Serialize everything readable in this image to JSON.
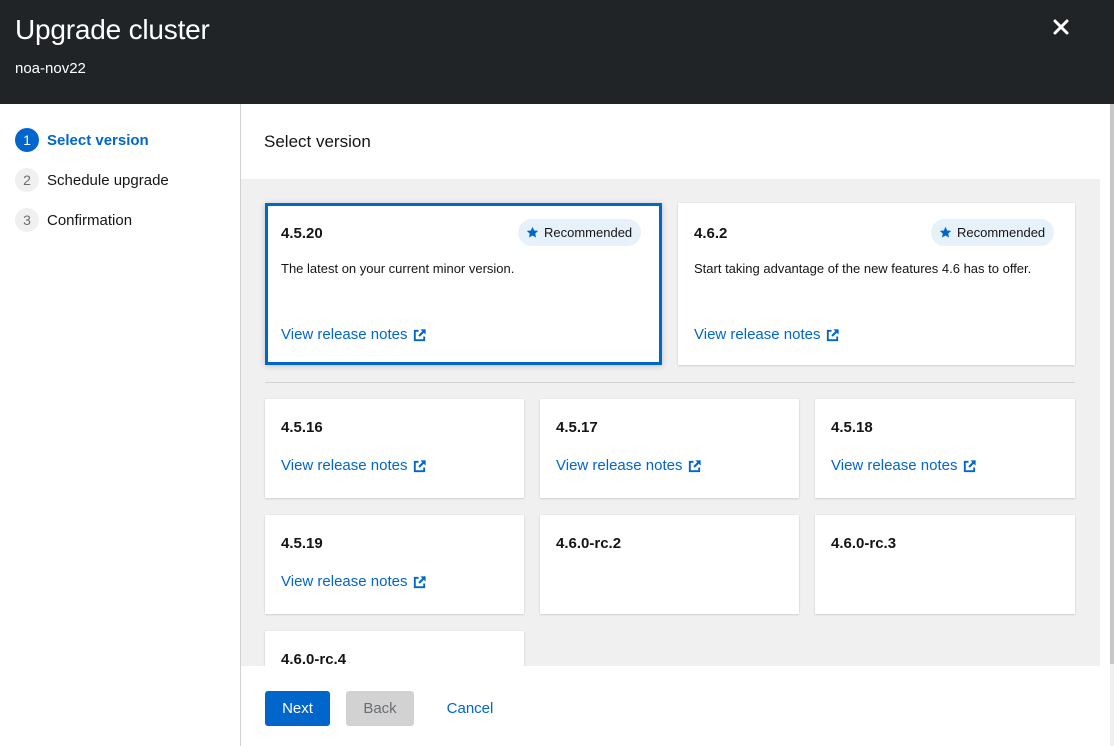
{
  "header": {
    "title": "Upgrade cluster",
    "subtitle": "noa-nov22"
  },
  "wizard_nav": [
    {
      "number": "1",
      "label": "Select version",
      "active": true
    },
    {
      "number": "2",
      "label": "Schedule upgrade",
      "active": false
    },
    {
      "number": "3",
      "label": "Confirmation",
      "active": false
    }
  ],
  "main": {
    "title": "Select version"
  },
  "recommended_cards": [
    {
      "version": "4.5.20",
      "badge": "Recommended",
      "description": "The latest on your current minor version.",
      "link": "View release notes",
      "selected": true
    },
    {
      "version": "4.6.2",
      "badge": "Recommended",
      "description": "Start taking advantage of the new features 4.6 has to offer.",
      "link": "View release notes",
      "selected": false
    }
  ],
  "version_cards": [
    {
      "version": "4.5.16",
      "link": "View release notes"
    },
    {
      "version": "4.5.17",
      "link": "View release notes"
    },
    {
      "version": "4.5.18",
      "link": "View release notes"
    },
    {
      "version": "4.5.19",
      "link": "View release notes"
    },
    {
      "version": "4.6.0-rc.2",
      "link": ""
    },
    {
      "version": "4.6.0-rc.3",
      "link": ""
    },
    {
      "version": "4.6.0-rc.4",
      "link": ""
    }
  ],
  "footer": {
    "next_label": "Next",
    "back_label": "Back",
    "cancel_label": "Cancel"
  },
  "colors": {
    "header_bg": "#212427",
    "accent": "#0066cc",
    "badge_bg": "#e7f1fa",
    "content_bg": "#f0f0f0"
  },
  "icons": {
    "close": "close-icon",
    "star": "star-icon",
    "external_link": "external-link-icon"
  }
}
